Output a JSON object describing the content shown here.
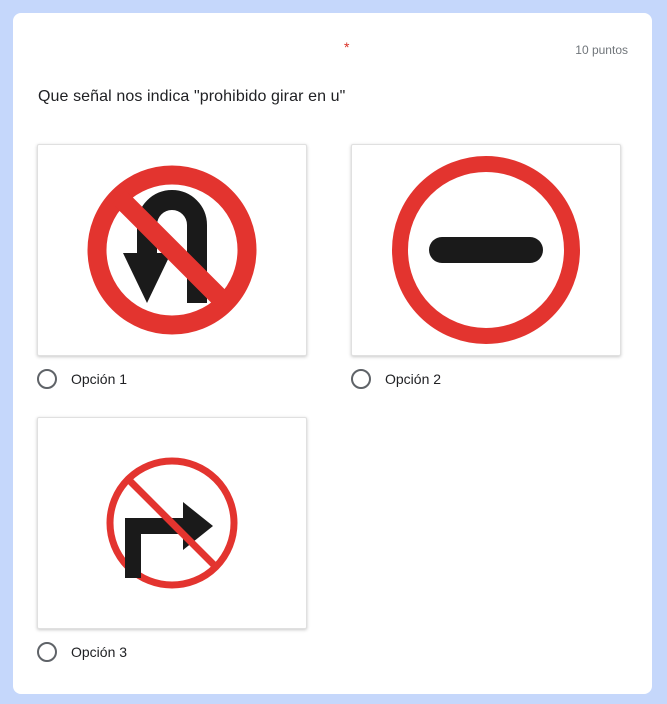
{
  "question": {
    "required_marker": "*",
    "points": "10 puntos",
    "title": "Que señal nos indica \"prohibido girar en u\""
  },
  "options": [
    {
      "label": "Opción 1",
      "image_icon": "no-u-turn-sign-icon"
    },
    {
      "label": "Opción 2",
      "image_icon": "no-entry-sign-icon"
    },
    {
      "label": "Opción 3",
      "image_icon": "no-right-turn-sign-icon"
    }
  ],
  "colors": {
    "background": "#c5d7fb",
    "sign_red": "#e3342f",
    "sign_black": "#1a1a1a",
    "required_red": "#d93025"
  }
}
